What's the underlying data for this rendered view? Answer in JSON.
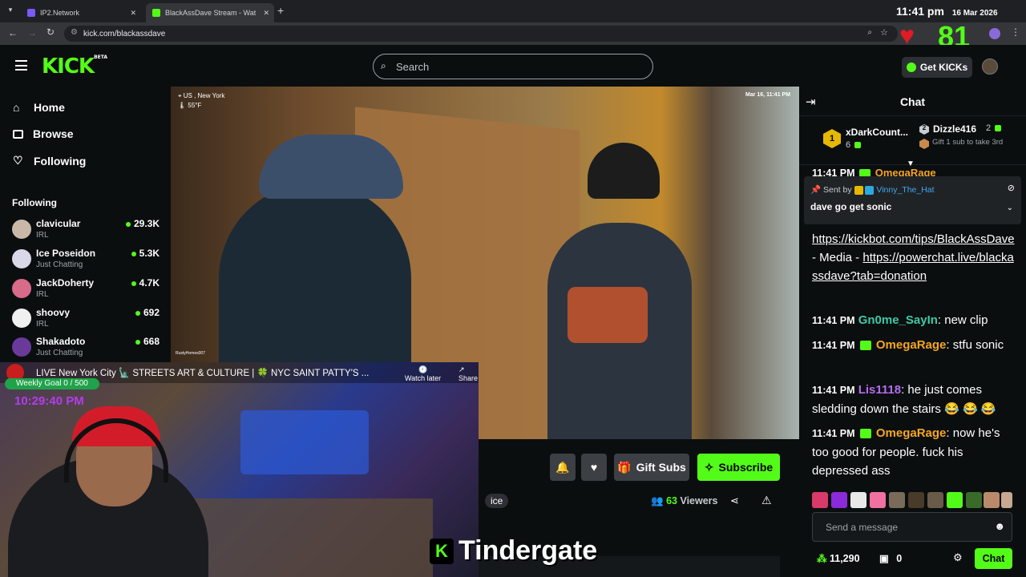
{
  "browser": {
    "tabs": [
      {
        "title": "IP2.Network"
      },
      {
        "title": "BlackAssDave Stream - Wat"
      }
    ],
    "url": "kick.com/blackassdave",
    "clock": "11:41 pm",
    "date": "16 Mar 2026"
  },
  "overlay": {
    "likes": "81"
  },
  "header": {
    "logo": "KICK",
    "logo_beta": "BETA",
    "search_placeholder": "Search",
    "get_kicks": "Get KICKs"
  },
  "sidebar": {
    "nav": [
      {
        "label": "Home",
        "icon": "home-icon"
      },
      {
        "label": "Browse",
        "icon": "browse-icon"
      },
      {
        "label": "Following",
        "icon": "heart-icon"
      }
    ],
    "following_title": "Following",
    "following": [
      {
        "name": "clavicular",
        "category": "IRL",
        "viewers": "29.3K",
        "color": "#c9b8a8"
      },
      {
        "name": "Ice Poseidon",
        "category": "Just Chatting",
        "viewers": "5.3K",
        "color": "#d8d8e8"
      },
      {
        "name": "JackDoherty",
        "category": "IRL",
        "viewers": "4.7K",
        "color": "#d86a8a"
      },
      {
        "name": "shoovy",
        "category": "IRL",
        "viewers": "692",
        "color": "#f0f0f0"
      },
      {
        "name": "Shakadoto",
        "category": "Just Chatting",
        "viewers": "668",
        "color": "#6a3a9a"
      }
    ]
  },
  "video": {
    "location": "US , New York",
    "temp": "55°F",
    "timestamp": "Mar 16, 11:41 PM",
    "watermark": "RustyHomes007"
  },
  "pip": {
    "title": "LIVE New York City 🗽 STREETS ART & CULTURE | 🍀 NYC SAINT PATTY'S ...",
    "watch_later": "Watch later",
    "share": "Share",
    "weekly_goal": "Weekly Goal 0 / 500",
    "clock": "10:29:40 PM"
  },
  "actions": {
    "gift_subs": "Gift Subs",
    "subscribe": "Subscribe",
    "tag": "ice",
    "viewers_count": "63",
    "viewers_label": "Viewers"
  },
  "caption": "Tindergate",
  "chat": {
    "title": "Chat",
    "leaderboard": [
      {
        "rank": "1",
        "name": "xDarkCount...",
        "count": "6"
      },
      {
        "rank": "2",
        "name": "Dizzle416",
        "count": "2"
      }
    ],
    "gift_hint": "Gift 1 sub to take 3rd",
    "pinned": {
      "sent_by_label": "Sent by",
      "sender": "Vinny_The_Hat",
      "text": "dave go get sonic"
    },
    "partial_top": {
      "time": "11:41 PM",
      "user": "OmegaRage"
    },
    "link_message": {
      "link1": "https://kickbot.com/tips/BlackAssDave",
      "mid": " - Media - ",
      "link2": "https://powerchat.live/blackassdave?tab=donation"
    },
    "messages": [
      {
        "time": "11:41 PM",
        "user": "Gn0me_SayIn",
        "text": "new clip"
      },
      {
        "time": "11:41 PM",
        "user": "OmegaRage",
        "text": "stfu sonic"
      },
      {
        "time": "11:41 PM",
        "user": "Lis1118",
        "text": "he just comes sledding down the stairs 😂 😂 😂"
      },
      {
        "time": "11:41 PM",
        "user": "OmegaRage",
        "text": "now he's too good for people. fuck his depressed ass"
      }
    ],
    "input_placeholder": "Send a message",
    "points": "11,290",
    "chests": "0",
    "chat_button": "Chat"
  }
}
